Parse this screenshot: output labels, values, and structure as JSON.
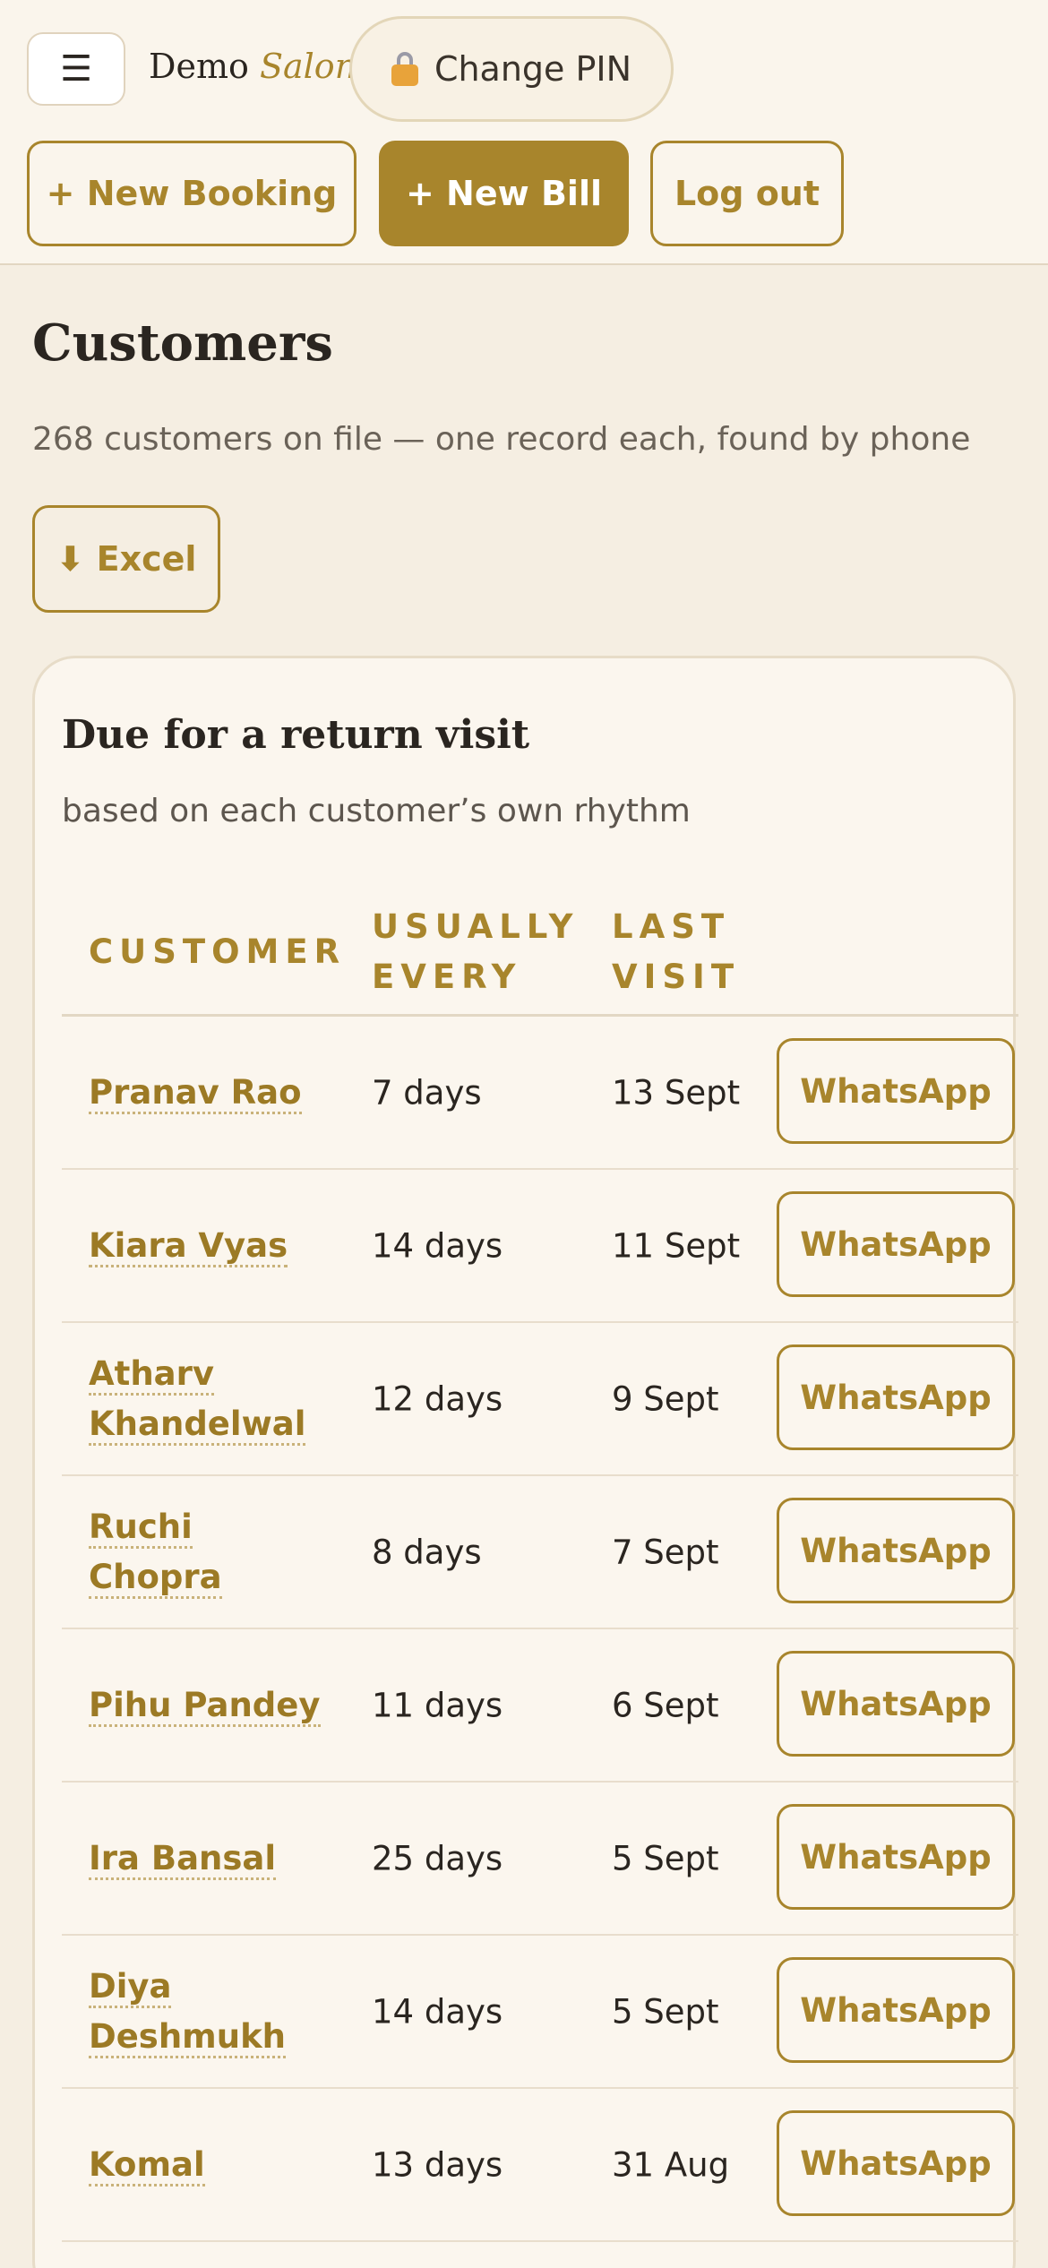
{
  "header": {
    "menu_icon": "☰",
    "brand_name": "Demo",
    "brand_accent": "Salon",
    "change_pin_label": "Change PIN",
    "new_booking_label": "+ New Booking",
    "new_bill_label": "+ New Bill",
    "logout_label": "Log out"
  },
  "page": {
    "title": "Customers",
    "subtitle": "268 customers on file — one record each, found by phone",
    "excel_label": "⬇ Excel"
  },
  "due_card": {
    "title": "Due for a return visit",
    "subtitle": "based on each customer’s own rhythm",
    "columns": {
      "customer": "CUSTOMER",
      "usually_every": "USUALLY EVERY",
      "last_visit": "LAST VISIT"
    },
    "action_label": "WhatsApp",
    "rows": [
      {
        "name": "Pranav Rao",
        "every": "7 days",
        "last": "13 Sept"
      },
      {
        "name": "Kiara Vyas",
        "every": "14 days",
        "last": "11 Sept"
      },
      {
        "name": "Atharv Khandelwal",
        "every": "12 days",
        "last": "9 Sept"
      },
      {
        "name": "Ruchi Chopra",
        "every": "8 days",
        "last": "7 Sept"
      },
      {
        "name": "Pihu Pandey",
        "every": "11 days",
        "last": "6 Sept"
      },
      {
        "name": "Ira Bansal",
        "every": "25 days",
        "last": "5 Sept"
      },
      {
        "name": "Diya Deshmukh",
        "every": "14 days",
        "last": "5 Sept"
      },
      {
        "name": "Komal",
        "every": "13 days",
        "last": "31 Aug"
      }
    ]
  },
  "colors": {
    "accent": "#a8852c",
    "background": "#f5eee2",
    "card": "#fbf6ee"
  }
}
